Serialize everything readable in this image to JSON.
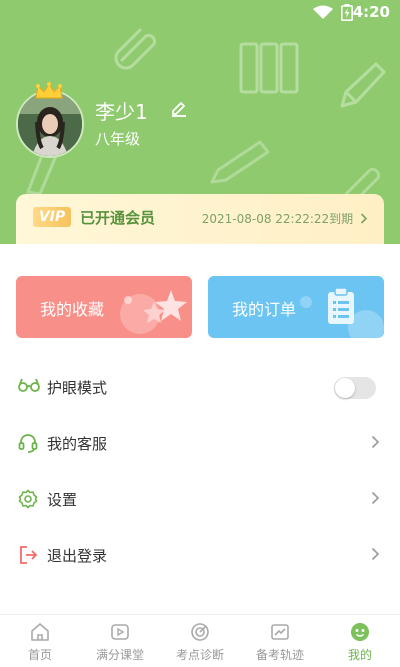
{
  "status_bar": {
    "time": "4:20"
  },
  "profile": {
    "name": "李少1",
    "grade": "八年级"
  },
  "vip": {
    "badge": "VIP",
    "title": "已开通会员",
    "expiry": "2021-08-08 22:22:22到期"
  },
  "cards": {
    "favorites": "我的收藏",
    "orders": "我的订单"
  },
  "menu": {
    "eye_mode": {
      "label": "护眼模式",
      "enabled": false
    },
    "service": "我的客服",
    "settings": "设置",
    "logout": "退出登录"
  },
  "tabs": [
    {
      "label": "首页",
      "icon": "home-icon"
    },
    {
      "label": "满分课堂",
      "icon": "play-icon"
    },
    {
      "label": "考点诊断",
      "icon": "target-icon"
    },
    {
      "label": "备考轨迹",
      "icon": "chart-icon"
    },
    {
      "label": "我的",
      "icon": "profile-icon"
    }
  ],
  "colors": {
    "header_green": "#8fcb6e",
    "accent_green": "#6cb44b",
    "fav_card": "#f88f88",
    "order_card": "#6bc4f2"
  }
}
